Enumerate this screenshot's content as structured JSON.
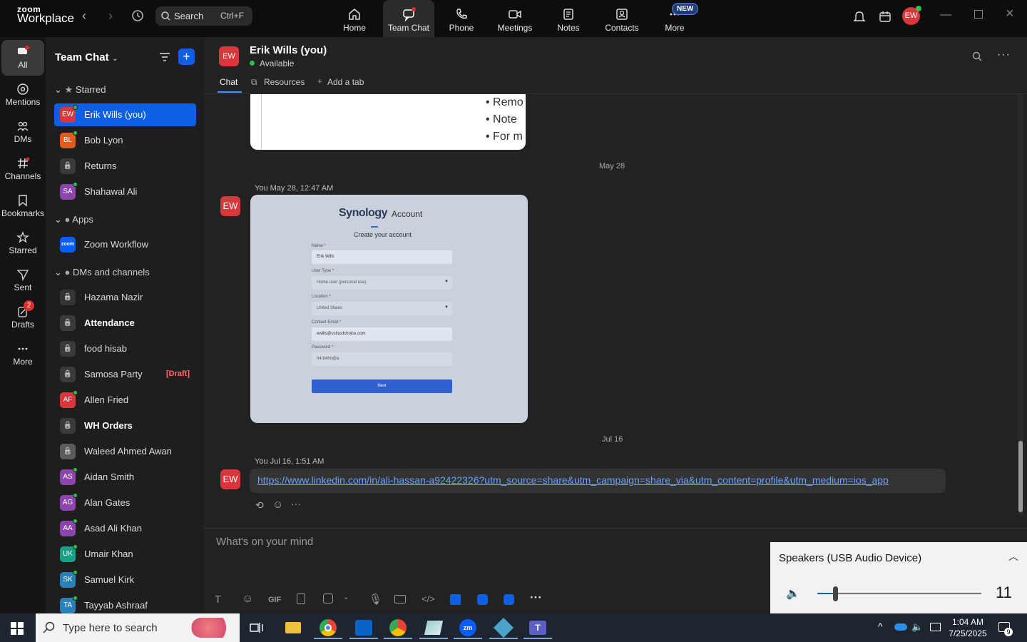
{
  "app": {
    "brand_small": "zoom",
    "brand_big": "Workplace"
  },
  "search": {
    "label": "Search",
    "shortcut": "Ctrl+F"
  },
  "nav_tabs": [
    {
      "label": "Home"
    },
    {
      "label": "Team Chat"
    },
    {
      "label": "Phone"
    },
    {
      "label": "Meetings"
    },
    {
      "label": "Notes"
    },
    {
      "label": "Contacts"
    },
    {
      "label": "More",
      "badge": "NEW"
    }
  ],
  "user_avatar": "EW",
  "rail": [
    {
      "label": "All"
    },
    {
      "label": "Mentions"
    },
    {
      "label": "DMs"
    },
    {
      "label": "Channels"
    },
    {
      "label": "Bookmarks"
    },
    {
      "label": "Starred"
    },
    {
      "label": "Sent"
    },
    {
      "label": "Drafts",
      "badge": "2"
    },
    {
      "label": "More"
    }
  ],
  "sidebar": {
    "title": "Team Chat",
    "sections": {
      "starred": "Starred",
      "apps": "Apps",
      "dms": "DMs and channels"
    },
    "starred": [
      {
        "initials": "EW",
        "name": "Erik Wills (you)",
        "color": "#d9373c"
      },
      {
        "initials": "BL",
        "name": "Bob Lyon",
        "color": "#e25a1c"
      },
      {
        "initials": "",
        "name": "Returns",
        "color": "#3a3a3a"
      },
      {
        "initials": "SA",
        "name": "Shahawal Ali",
        "color": "#8e44ad"
      }
    ],
    "apps": [
      {
        "initials": "zoom",
        "name": "Zoom Workflow",
        "color": "#0b5cff"
      }
    ],
    "dms": [
      {
        "initials": "",
        "name": "Hazama Nazir",
        "color": "#5a2a35"
      },
      {
        "initials": "",
        "name": "Attendance",
        "color": "#3a3a3a",
        "bold": true
      },
      {
        "initials": "",
        "name": "food hisab",
        "color": "#3a3a3a"
      },
      {
        "initials": "",
        "name": "Samosa Party",
        "color": "#3a3a3a",
        "tag": "[Draft]"
      },
      {
        "initials": "AF",
        "name": "Allen Fried",
        "color": "#d9373c"
      },
      {
        "initials": "",
        "name": "WH Orders",
        "color": "#3a3a3a",
        "bold": true
      },
      {
        "initials": "",
        "name": "Waleed Ahmed Awan",
        "color": "#6a5a4a"
      },
      {
        "initials": "AS",
        "name": "Aidan Smith",
        "color": "#8e44ad"
      },
      {
        "initials": "AG",
        "name": "Alan Gates",
        "color": "#8e44ad"
      },
      {
        "initials": "AA",
        "name": "Asad Ali Khan",
        "color": "#8e44ad"
      },
      {
        "initials": "UK",
        "name": "Umair Khan",
        "color": "#16a085"
      },
      {
        "initials": "SK",
        "name": "Samuel Kirk",
        "color": "#2980b9"
      },
      {
        "initials": "TA",
        "name": "Tayyab Ashraaf",
        "color": "#2980b9"
      }
    ]
  },
  "chat": {
    "name": "Erik Wills (you)",
    "status": "Available",
    "tabs": {
      "chat": "Chat",
      "resources": "Resources",
      "add": "Add a tab"
    },
    "prev_bullets": [
      "Remo",
      "Note",
      "For m"
    ],
    "date1": "May 28",
    "meta1": "You May 28, 12:47 AM",
    "synology": {
      "brand": "Synology",
      "account": "Account",
      "subtitle": "Create your account",
      "name_label": "Name *",
      "name_value": "Erik Wills",
      "usertype_label": "User Type *",
      "usertype_value": "Home user (personal use)",
      "location_label": "Location *",
      "location_value": "United States",
      "email_label": "Contact Email *",
      "email_value": "ewills@vcloudchoice.com",
      "password_label": "Password *",
      "password_value": "h4rd4hn@a",
      "next": "Next"
    },
    "date2": "Jul 16",
    "meta2": "You Jul 16, 1:51 AM",
    "link": "https://www.linkedin.com/in/ali-hassan-a92422326?utm_source=share&utm_campaign=share_via&utm_content=profile&utm_medium=ios_app",
    "composer_placeholder": "What's on your mind"
  },
  "speaker": {
    "title": "Speakers (USB Audio Device)",
    "volume": "11",
    "level": 0.11
  },
  "taskbar": {
    "search": "Type here to search",
    "time": "1:04 AM",
    "date": "7/25/2025",
    "notif": "9"
  },
  "colors": {
    "accent": "#0e5ee6",
    "brand_red": "#d9373c",
    "online": "#2fbf4a"
  }
}
